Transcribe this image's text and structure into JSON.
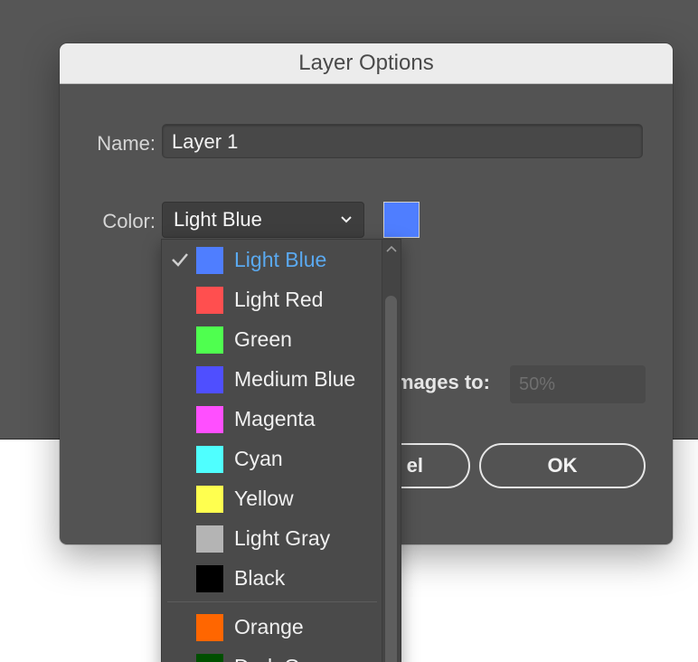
{
  "dialog": {
    "title": "Layer Options",
    "name_label": "Name:",
    "name_value": "Layer 1",
    "color_label": "Color:",
    "color_selected": "Light Blue",
    "thumbnail_label_visible": "mages to:",
    "thumbnail_value": "50%",
    "cancel_label_visible": "el",
    "ok_label": "OK"
  },
  "colors": {
    "selected_swatch": "#4f7eff",
    "selected_text": "#5aa9f0"
  },
  "dropdown": {
    "items": [
      {
        "label": "Light Blue",
        "color": "#4f7eff",
        "checked": true
      },
      {
        "label": "Light Red",
        "color": "#ff4f4f",
        "checked": false
      },
      {
        "label": "Green",
        "color": "#4fff4f",
        "checked": false
      },
      {
        "label": "Medium Blue",
        "color": "#4f4fff",
        "checked": false
      },
      {
        "label": "Magenta",
        "color": "#ff4fff",
        "checked": false
      },
      {
        "label": "Cyan",
        "color": "#4fffff",
        "checked": false
      },
      {
        "label": "Yellow",
        "color": "#ffff4f",
        "checked": false
      },
      {
        "label": "Light Gray",
        "color": "#b4b4b4",
        "checked": false
      },
      {
        "label": "Black",
        "color": "#000000",
        "checked": false
      },
      {
        "label": "Orange",
        "color": "#ff6600",
        "checked": false
      },
      {
        "label": "Dark G",
        "color": "#004f00",
        "checked": false
      }
    ]
  }
}
